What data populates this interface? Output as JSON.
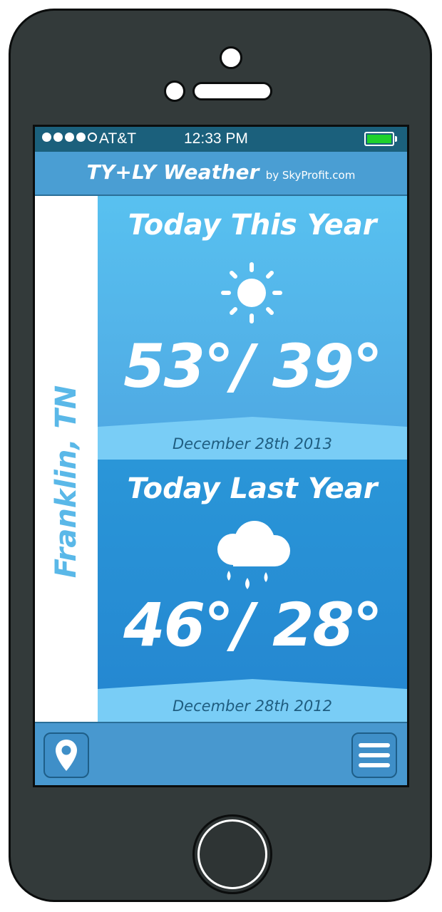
{
  "status_bar": {
    "carrier": "AT&T",
    "time": "12:33 PM",
    "signal_bars": 4,
    "signal_total": 5,
    "battery_level": 1.0,
    "battery_color": "#1fd22c"
  },
  "header": {
    "title": "TY+LY Weather",
    "subtitle": "by SkyProfit.com"
  },
  "location": {
    "city": "Franklin, TN"
  },
  "today_this_year": {
    "title": "Today This Year",
    "condition_icon": "sun-icon",
    "temps": "53°/ 39°",
    "date": "December 28th 2013"
  },
  "today_last_year": {
    "title": "Today Last Year",
    "condition_icon": "rain-cloud-icon",
    "temps": "46°/ 28°",
    "date": "December 28th 2012"
  },
  "toolbar": {
    "location_icon": "map-pin-icon",
    "menu_icon": "hamburger-menu-icon"
  },
  "colors": {
    "accent": "#4a9ed3",
    "city_text": "#5ab8e8",
    "date_band": "#79cdf6"
  }
}
